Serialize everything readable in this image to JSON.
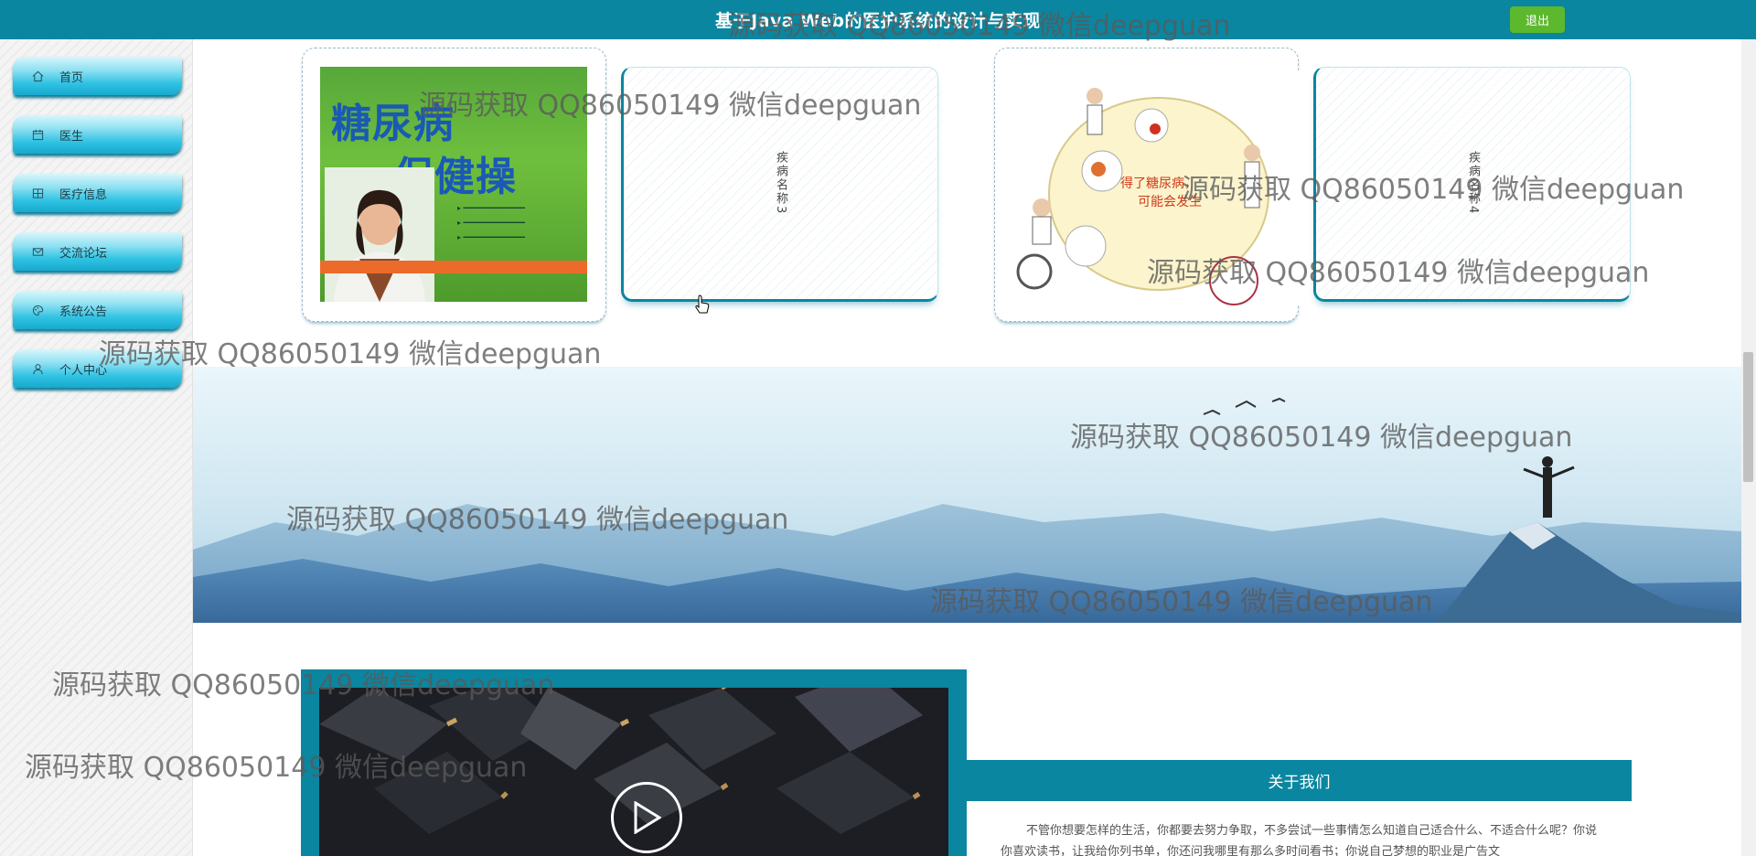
{
  "header": {
    "title": "基于Java Web的医护系统的设计与实现",
    "logout_label": "退出"
  },
  "sidebar": {
    "items": [
      {
        "label": "首页",
        "icon": "home-icon"
      },
      {
        "label": "医生",
        "icon": "calendar-icon"
      },
      {
        "label": "医疗信息",
        "icon": "grid-icon"
      },
      {
        "label": "交流论坛",
        "icon": "mail-icon"
      },
      {
        "label": "系统公告",
        "icon": "palette-icon"
      },
      {
        "label": "个人中心",
        "icon": "user-icon"
      }
    ]
  },
  "cards": {
    "book": {
      "title_line1": "糖尿病",
      "title_line2": "保健操"
    },
    "card3_text": "疾病名称3",
    "card4_text": "疾病名称4",
    "illustration": {
      "center_text": "得了糖尿病，可能会发生"
    }
  },
  "about": {
    "heading": "关于我们",
    "body": "不管你想要怎样的生活，你都要去努力争取，不多尝试一些事情怎么知道自己适合什么、不适合什么呢？你说你喜欢读书，让我给你列书单，你还问我哪里有那么多时间看书；你说自己梦想的职业是广告文"
  },
  "watermark": "源码获取 QQ86050149 微信deepguan",
  "colors": {
    "primary": "#0a86a0",
    "logout": "#5cb82c"
  }
}
